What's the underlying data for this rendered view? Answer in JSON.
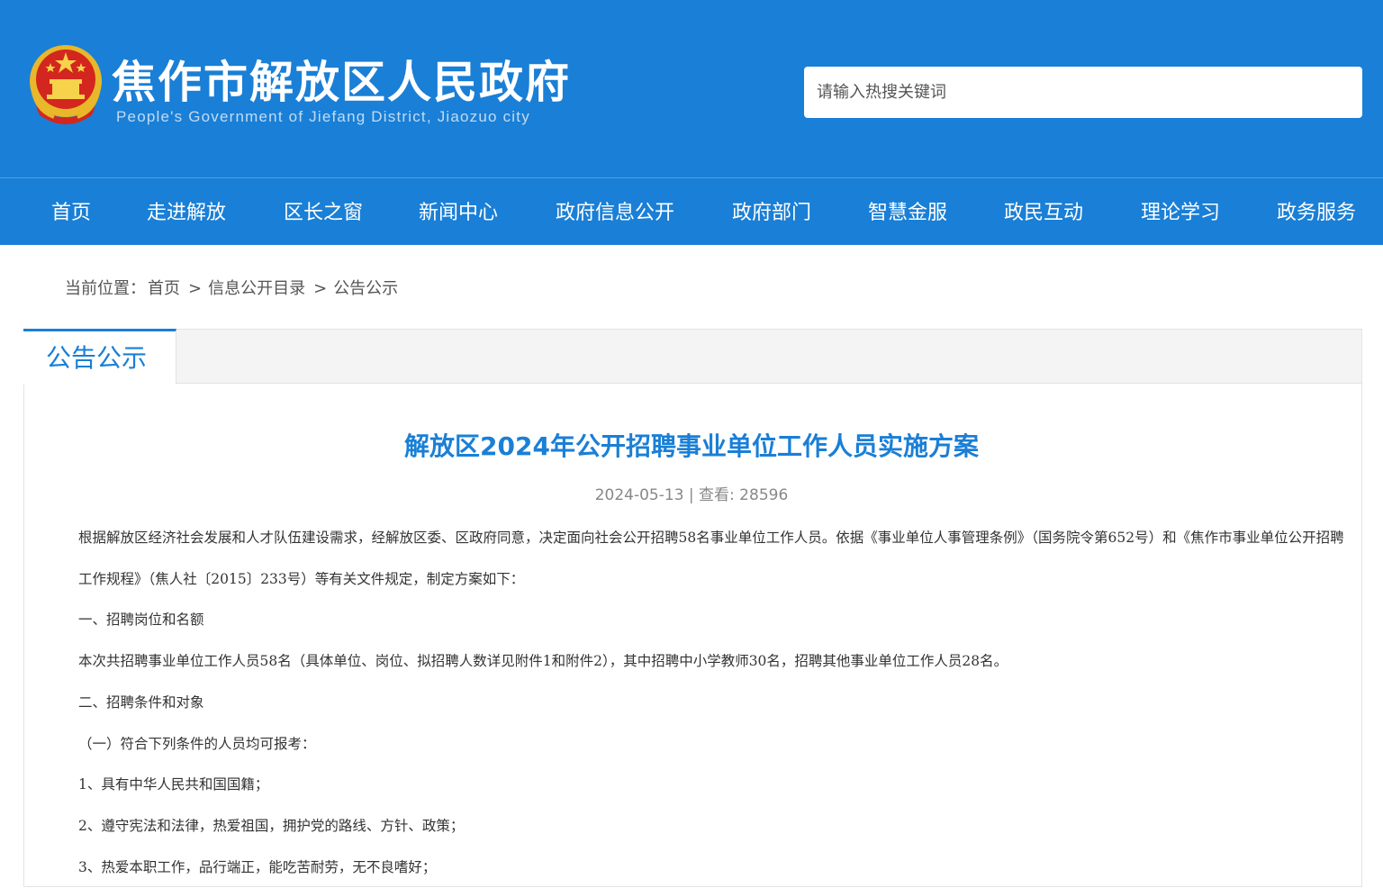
{
  "header": {
    "title": "焦作市解放区人民政府",
    "subtitle": "People's Government of Jiefang District, Jiaozuo city",
    "emblem_icon": "national-emblem-icon",
    "search_placeholder": "请输入热搜关键词"
  },
  "nav": {
    "items": [
      {
        "label": "首页"
      },
      {
        "label": "走进解放"
      },
      {
        "label": "区长之窗"
      },
      {
        "label": "新闻中心"
      },
      {
        "label": "政府信息公开"
      },
      {
        "label": "政府部门"
      },
      {
        "label": "智慧金服"
      },
      {
        "label": "政民互动"
      },
      {
        "label": "理论学习"
      },
      {
        "label": "政务服务"
      }
    ]
  },
  "breadcrumb": {
    "prefix": "当前位置：",
    "items": [
      "首页",
      "信息公开目录",
      "公告公示"
    ],
    "separator": ">"
  },
  "panel": {
    "tab_label": "公告公示"
  },
  "article": {
    "title": "解放区2024年公开招聘事业单位工作人员实施方案",
    "meta": "2024-05-13 | 查看: 28596",
    "paragraphs": [
      "根据解放区经济社会发展和人才队伍建设需求，经解放区委、区政府同意，决定面向社会公开招聘58名事业单位工作人员。依据《事业单位人事管理条例》（国务院令第652号）和《焦作市事业单位公开招聘工作规程》（焦人社〔2015〕233号）等有关文件规定，制定方案如下：",
      "一、招聘岗位和名额",
      "本次共招聘事业单位工作人员58名（具体单位、岗位、拟招聘人数详见附件1和附件2），其中招聘中小学教师30名，招聘其他事业单位工作人员28名。",
      "二、招聘条件和对象",
      "（一）符合下列条件的人员均可报考：",
      "1、具有中华人民共和国国籍；",
      "2、遵守宪法和法律，热爱祖国，拥护党的路线、方针、政策；",
      "3、热爱本职工作，品行端正，能吃苦耐劳，无不良嗜好；"
    ]
  },
  "colors": {
    "brand_blue": "#1a7fd6",
    "header_text": "#ffffff",
    "title_blue": "#1a7fd6"
  }
}
